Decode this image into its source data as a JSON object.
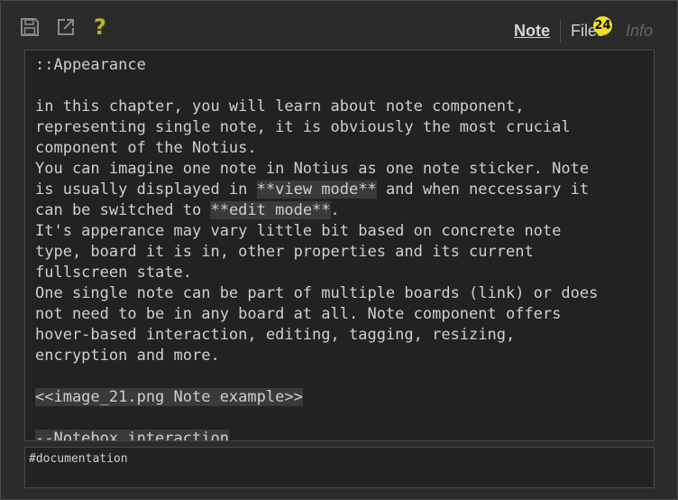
{
  "toolbar": {
    "icons": [
      "save-icon",
      "open-external-icon",
      "help-icon"
    ],
    "help_glyph": "?",
    "tabs": {
      "note": "Note",
      "files": "Files",
      "files_count": "24",
      "info": "Info"
    },
    "colors": {
      "icon": "#8a8a8a",
      "help": "#b5b52a",
      "badge": "#f0e01f"
    }
  },
  "editor": {
    "lines": [
      {
        "text": "::Appearance"
      },
      {
        "text": ""
      },
      {
        "text": "in this chapter, you will learn about note component,"
      },
      {
        "text": "representing single note, it is obviously the most crucial"
      },
      {
        "text": "component of the Notius."
      },
      {
        "text": "You can imagine one note in Notius as one note sticker. Note"
      },
      {
        "parts": [
          "is usually displayed in ",
          "**view mode**",
          " and when neccessary it"
        ]
      },
      {
        "parts": [
          "can be switched to ",
          "**edit mode**",
          "."
        ]
      },
      {
        "text": "It's apperance may vary little bit based on concrete note"
      },
      {
        "text": "type, board it is in, other properties and its current"
      },
      {
        "text": "fullscreen state."
      },
      {
        "text": "One single note can be part of multiple boards (link) or does"
      },
      {
        "text": "not need to be in any board at all. Note component offers"
      },
      {
        "text": "hover-based interaction, editing, tagging, resizing,"
      },
      {
        "text": "encryption and more."
      },
      {
        "text": ""
      },
      {
        "highlight": "<<image_21.png Note example>>"
      },
      {
        "text": ""
      },
      {
        "highlight": "--Notebox interaction"
      }
    ]
  },
  "tags": {
    "value": "#documentation"
  }
}
